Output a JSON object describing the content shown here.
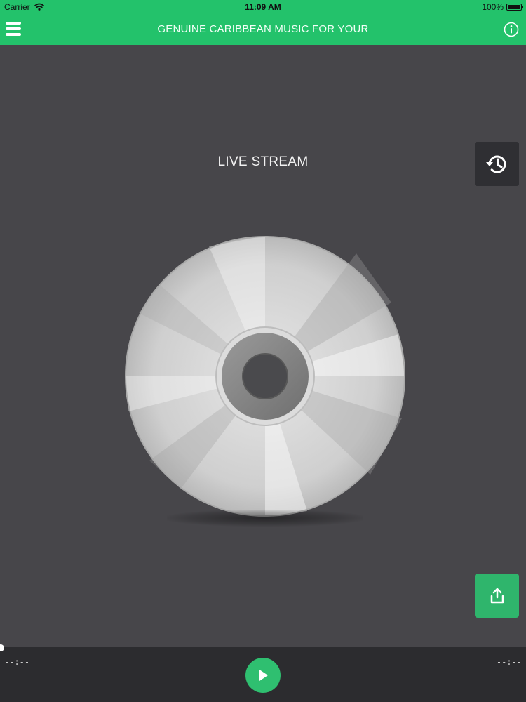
{
  "status_bar": {
    "carrier": "Carrier",
    "time": "11:09 AM",
    "battery_percent": "100%",
    "battery_level": 1.0
  },
  "nav": {
    "title": "GENUINE CARIBBEAN MUSIC FOR YOUR",
    "menu_icon": "hamburger-icon",
    "info_icon": "info-icon"
  },
  "main": {
    "stream_label": "LIVE STREAM",
    "history_icon": "history-icon",
    "disc_icon": "compact-disc-icon",
    "share_icon": "share-icon"
  },
  "player": {
    "elapsed": "--:--",
    "remaining": "--:--",
    "progress": 0,
    "play_icon": "play-icon"
  },
  "colors": {
    "accent": "#23c26b",
    "background": "#47464a",
    "player_bg": "#2c2c2f",
    "history_button_bg": "#2f2f33",
    "share_button_bg": "#2fb56c"
  }
}
